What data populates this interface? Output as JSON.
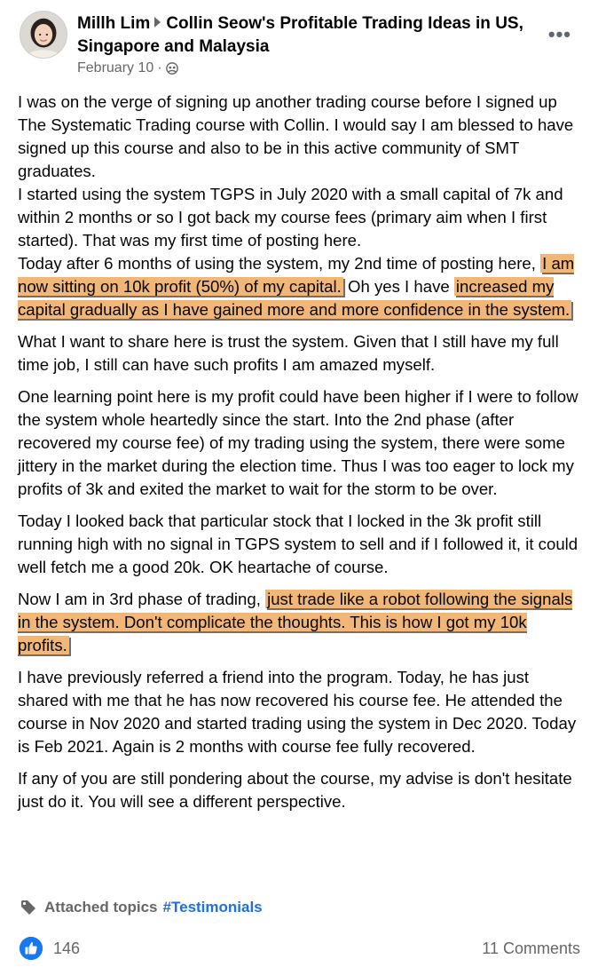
{
  "header": {
    "author": "Millh Lim",
    "group": "Collin Seow's Profitable Trading Ideas in US, Singapore and Malaysia",
    "date": "February 10",
    "audience_icon": "group-globe-icon",
    "more_icon": "more-options-icon"
  },
  "post": {
    "p1_t1": "I was on the verge of signing up another trading course before I signed up The Systematic Trading course with Collin. I would say I am blessed to have signed up this course and also to be in this active community of SMT graduates.",
    "p1_t2": "I started using the system TGPS in July 2020 with a small capital of 7k and within 2 months or so I got back my course fees (primary aim when I first started). That was my first time of posting here.",
    "p1_t3": "Today after 6 months of using the system, my 2nd time of posting here,",
    "p1_hl1": "I am now sitting on 10k profit (50%) of my capital.",
    "p1_t4": "Oh yes I have",
    "p1_hl2": "increased my capital gradually as I have gained more and more confidence in the system.",
    "p2": "What I want to share here is trust the system. Given that I still have my full time job, I still can have such profits I am amazed myself.",
    "p3": "One learning point here is my profit could have been higher if I were to follow the system whole heartedly since the start. Into the 2nd phase (after recovered my course fee) of my trading using the system, there were some jittery in the market during the election time. Thus I was too eager to lock my profits of 3k and exited the market to wait for the storm to be over.",
    "p4": "Today I looked back that particular stock that I locked in the 3k profit still running high with no signal in  TGPS system to sell and if I followed it, it could well fetch me a good 20k. OK heartache of course.",
    "p5_t1": "Now I am in 3rd phase of trading,",
    "p5_hl": "just trade like a robot following the signals in the system. Don't complicate the thoughts. This is how I got my 10k profits.",
    "p6": "I have previously referred a friend into the program. Today, he has just shared with me that he has now recovered his course fee. He attended the course in Nov 2020 and started trading using the system in Dec 2020. Today is Feb 2021. Again is 2 months with course fee fully recovered.",
    "p7": "If any of you are still pondering about the course, my advise is don't hesitate just do it. You will see a different perspective."
  },
  "topics": {
    "label": "Attached topics",
    "tag": "#Testimonials",
    "icon": "tag-icon"
  },
  "footer": {
    "likes": "146",
    "comments": "11 Comments",
    "like_icon": "thumbs-up-icon"
  },
  "colors": {
    "highlight": "#f1b778",
    "link": "#216fdb",
    "muted": "#65676b",
    "like": "#1877f2"
  }
}
